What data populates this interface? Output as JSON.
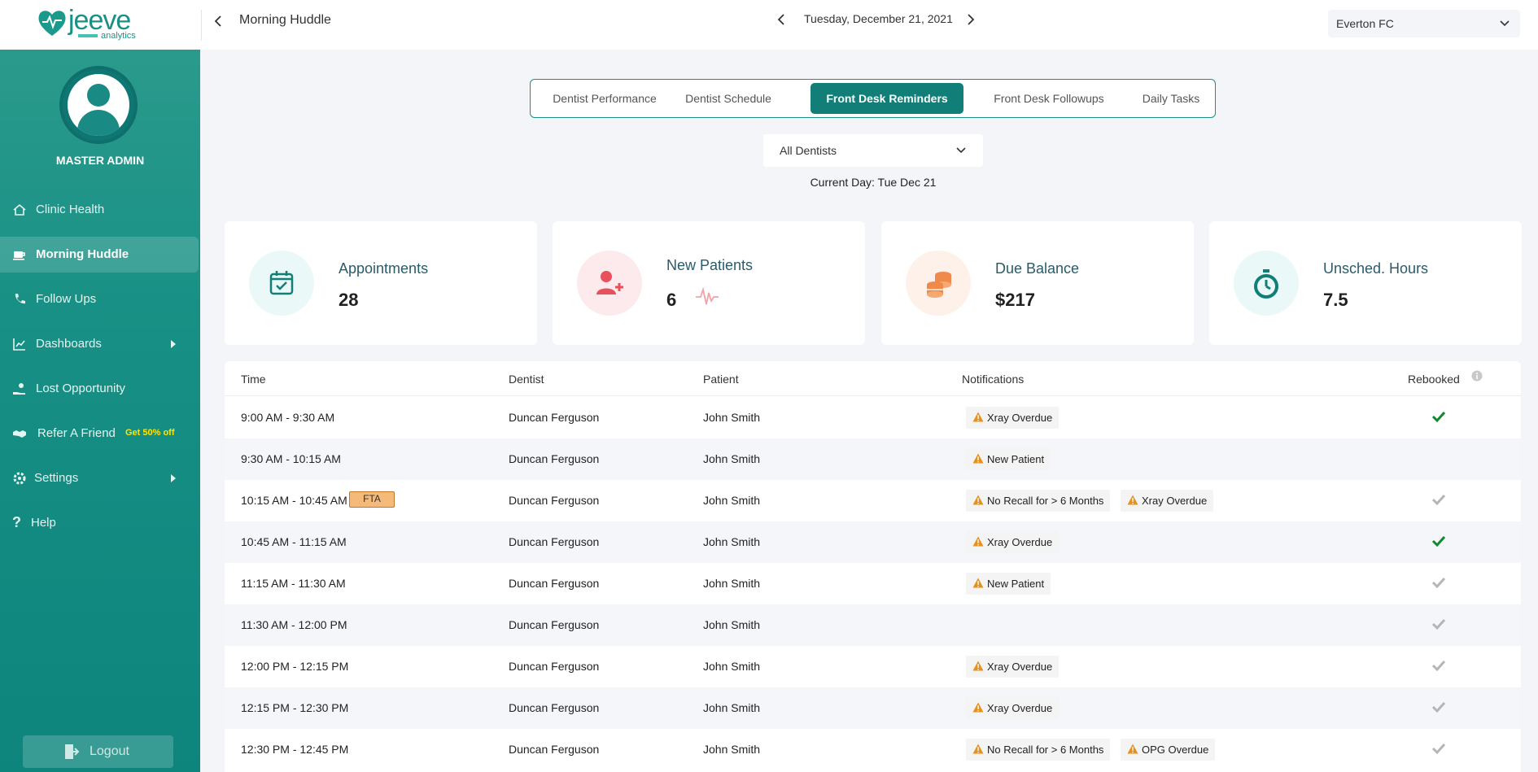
{
  "header": {
    "logo_word": "jeeve",
    "logo_sub": "analytics",
    "page_title": "Morning Huddle",
    "date": "Tuesday, December 21, 2021",
    "clinic": "Everton FC"
  },
  "sidebar": {
    "user_name": "MASTER ADMIN",
    "items": [
      {
        "label": "Clinic Health",
        "icon": "home-icon"
      },
      {
        "label": "Morning Huddle",
        "icon": "coffee-cup-icon",
        "active": true
      },
      {
        "label": "Follow Ups",
        "icon": "phone-icon"
      },
      {
        "label": "Dashboards",
        "icon": "chart-icon",
        "expandable": true
      },
      {
        "label": "Lost Opportunity",
        "icon": "hand-coin-icon"
      },
      {
        "label": "Refer A Friend",
        "icon": "handshake-icon",
        "promo": "Get 50% off"
      },
      {
        "label": "Settings",
        "icon": "gear-icon",
        "expandable": true
      },
      {
        "label": "Help",
        "icon": "question-icon"
      }
    ],
    "logout": "Logout"
  },
  "tabs": [
    "Dentist Performance",
    "Dentist Schedule",
    "Front Desk Reminders",
    "Front Desk Followups",
    "Daily Tasks"
  ],
  "active_tab": "Front Desk Reminders",
  "filter": {
    "dentist": "All Dentists",
    "current_day": "Current Day: Tue Dec 21"
  },
  "kpis": [
    {
      "title": "Appointments",
      "value": "28",
      "icon": "calendar-check-icon",
      "color": "#117f78"
    },
    {
      "title": "New Patients",
      "value": "6",
      "icon": "add-user-icon",
      "color": "#e8505b"
    },
    {
      "title": "Due Balance",
      "value": "$217",
      "icon": "coins-icon",
      "color": "#f08a4b"
    },
    {
      "title": "Unsched. Hours",
      "value": "7.5",
      "icon": "stopwatch-icon",
      "color": "#117f78"
    }
  ],
  "table": {
    "headers": {
      "time": "Time",
      "dentist": "Dentist",
      "patient": "Patient",
      "notifications": "Notifications",
      "rebooked": "Rebooked"
    },
    "rows": [
      {
        "time": "9:00 AM - 9:30 AM",
        "dentist": "Duncan Ferguson",
        "patient": "John Smith",
        "notifications": [
          "Xray Overdue"
        ],
        "rebooked": true
      },
      {
        "time": "9:30 AM - 10:15 AM",
        "dentist": "Duncan Ferguson",
        "patient": "John Smith",
        "notifications": [
          "New Patient"
        ],
        "rebooked": null
      },
      {
        "time": "10:15 AM - 10:45 AM",
        "tag": "FTA",
        "dentist": "Duncan Ferguson",
        "patient": "John Smith",
        "notifications": [
          "No Recall for > 6 Months",
          "Xray Overdue"
        ],
        "rebooked": false
      },
      {
        "time": "10:45 AM - 11:15 AM",
        "dentist": "Duncan Ferguson",
        "patient": "John Smith",
        "notifications": [
          "Xray Overdue"
        ],
        "rebooked": true
      },
      {
        "time": "11:15 AM - 11:30 AM",
        "dentist": "Duncan Ferguson",
        "patient": "John Smith",
        "notifications": [
          "New Patient"
        ],
        "rebooked": false
      },
      {
        "time": "11:30 AM - 12:00 PM",
        "dentist": "Duncan Ferguson",
        "patient": "John Smith",
        "notifications": [],
        "rebooked": false
      },
      {
        "time": "12:00 PM - 12:15 PM",
        "dentist": "Duncan Ferguson",
        "patient": "John Smith",
        "notifications": [
          "Xray Overdue"
        ],
        "rebooked": false
      },
      {
        "time": "12:15 PM - 12:30 PM",
        "dentist": "Duncan Ferguson",
        "patient": "John Smith",
        "notifications": [
          "Xray Overdue"
        ],
        "rebooked": false
      },
      {
        "time": "12:30 PM - 12:45 PM",
        "dentist": "Duncan Ferguson",
        "patient": "John Smith",
        "notifications": [
          "No Recall for > 6 Months",
          "OPG Overdue"
        ],
        "rebooked": false
      }
    ]
  },
  "colors": {
    "brand": "#117f78",
    "rebooked_yes": "#0e8a2e",
    "rebooked_no": "#b5b5b5",
    "warning": "#e8901c"
  }
}
